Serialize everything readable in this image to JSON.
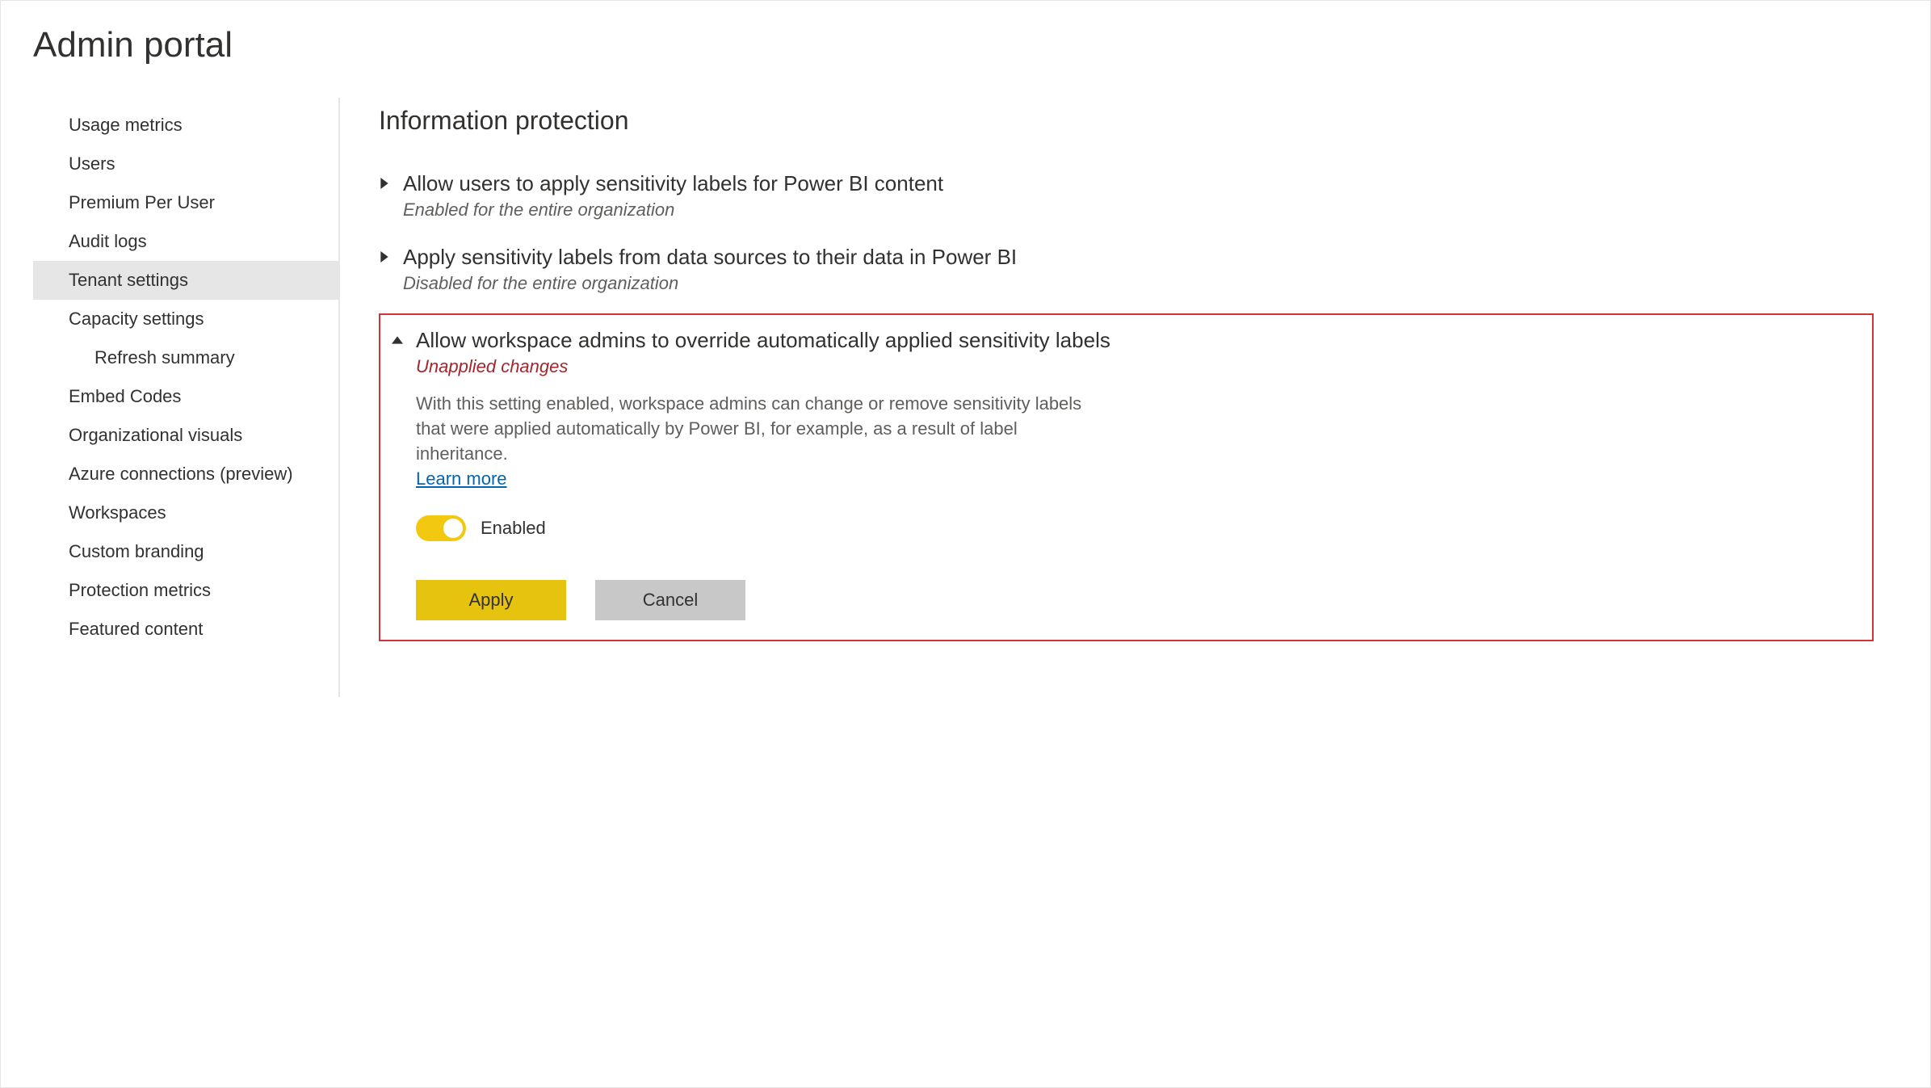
{
  "page_title": "Admin portal",
  "sidebar": {
    "items": [
      {
        "label": "Usage metrics",
        "selected": false,
        "child": false
      },
      {
        "label": "Users",
        "selected": false,
        "child": false
      },
      {
        "label": "Premium Per User",
        "selected": false,
        "child": false
      },
      {
        "label": "Audit logs",
        "selected": false,
        "child": false
      },
      {
        "label": "Tenant settings",
        "selected": true,
        "child": false
      },
      {
        "label": "Capacity settings",
        "selected": false,
        "child": false
      },
      {
        "label": "Refresh summary",
        "selected": false,
        "child": true
      },
      {
        "label": "Embed Codes",
        "selected": false,
        "child": false
      },
      {
        "label": "Organizational visuals",
        "selected": false,
        "child": false
      },
      {
        "label": "Azure connections (preview)",
        "selected": false,
        "child": false
      },
      {
        "label": "Workspaces",
        "selected": false,
        "child": false
      },
      {
        "label": "Custom branding",
        "selected": false,
        "child": false
      },
      {
        "label": "Protection metrics",
        "selected": false,
        "child": false
      },
      {
        "label": "Featured content",
        "selected": false,
        "child": false
      }
    ]
  },
  "main": {
    "section_title": "Information protection",
    "settings": [
      {
        "expanded": false,
        "title": "Allow users to apply sensitivity labels for Power BI content",
        "status": "Enabled for the entire organization",
        "status_kind": "normal"
      },
      {
        "expanded": false,
        "title": "Apply sensitivity labels from data sources to their data in Power BI",
        "status": "Disabled for the entire organization",
        "status_kind": "normal"
      },
      {
        "expanded": true,
        "highlighted": true,
        "title": "Allow workspace admins to override automatically applied sensitivity labels",
        "status": "Unapplied changes",
        "status_kind": "changes",
        "description": "With this setting enabled, workspace admins can change or remove sensitivity labels that were applied automatically by Power BI, for example, as a result of label inheritance.",
        "learn_more": "Learn more",
        "toggle_enabled": true,
        "toggle_label": "Enabled",
        "apply_label": "Apply",
        "cancel_label": "Cancel"
      }
    ]
  }
}
